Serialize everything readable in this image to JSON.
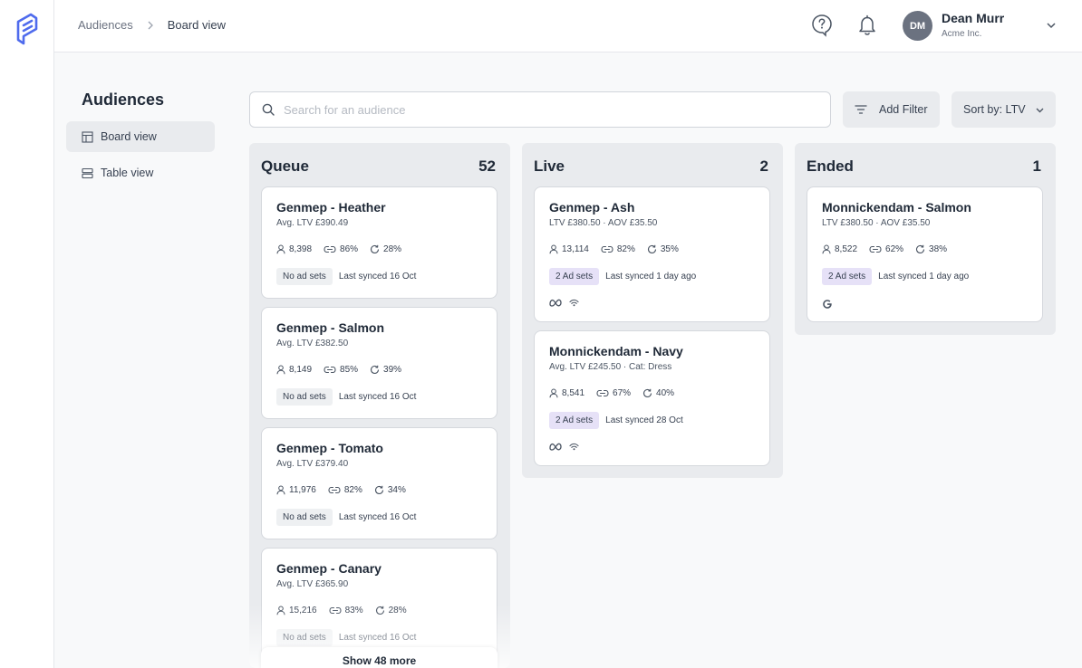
{
  "breadcrumb": {
    "parent": "Audiences",
    "current": "Board view"
  },
  "user": {
    "initials": "DM",
    "name": "Dean Murr",
    "org": "Acme Inc."
  },
  "sidebar": {
    "title": "Audiences",
    "items": [
      {
        "label": "Board view",
        "icon": "board-icon",
        "active": true
      },
      {
        "label": "Table view",
        "icon": "table-icon",
        "active": false
      }
    ]
  },
  "search": {
    "placeholder": "Search for an audience",
    "value": ""
  },
  "toolbar": {
    "filter_label": "Add Filter",
    "sort_label": "Sort by: LTV"
  },
  "columns": [
    {
      "title": "Queue",
      "count": "52",
      "show_more": "Show 48 more",
      "cards": [
        {
          "title": "Genmep - Heather",
          "sub": "Avg. LTV £390.49",
          "users": "8,398",
          "links": "86%",
          "sync": "28%",
          "tag": "No ad sets",
          "synced": "Last synced 16 Oct"
        },
        {
          "title": "Genmep - Salmon",
          "sub": "Avg. LTV £382.50",
          "users": "8,149",
          "links": "85%",
          "sync": "39%",
          "tag": "No ad sets",
          "synced": "Last synced 16 Oct"
        },
        {
          "title": "Genmep - Tomato",
          "sub": "Avg. LTV £379.40",
          "users": "11,976",
          "links": "82%",
          "sync": "34%",
          "tag": "No ad sets",
          "synced": "Last synced 16 Oct"
        },
        {
          "title": "Genmep - Canary",
          "sub": "Avg. LTV £365.90",
          "users": "15,216",
          "links": "83%",
          "sync": "28%",
          "tag": "No ad sets",
          "synced": "Last synced 16 Oct"
        }
      ]
    },
    {
      "title": "Live",
      "count": "2",
      "cards": [
        {
          "title": "Genmep - Ash",
          "sub": "LTV £380.50 · AOV £35.50",
          "users": "13,114",
          "links": "82%",
          "sync": "35%",
          "tag": "2 Ad sets",
          "synced": "Last synced 1 day ago",
          "channels": [
            "meta-icon",
            "signal-icon"
          ]
        },
        {
          "title": "Monnickendam - Navy",
          "sub": "Avg. LTV £245.50 · Cat: Dress",
          "users": "8,541",
          "links": "67%",
          "sync": "40%",
          "tag": "2 Ad sets",
          "synced": "Last synced 28 Oct",
          "channels": [
            "meta-icon",
            "signal-icon"
          ]
        }
      ]
    },
    {
      "title": "Ended",
      "count": "1",
      "cards": [
        {
          "title": "Monnickendam - Salmon",
          "sub": "LTV £380.50 · AOV £35.50",
          "users": "8,522",
          "links": "62%",
          "sync": "38%",
          "tag": "2 Ad sets",
          "synced": "Last synced 1 day ago",
          "channels": [
            "google-icon"
          ]
        }
      ]
    }
  ]
}
